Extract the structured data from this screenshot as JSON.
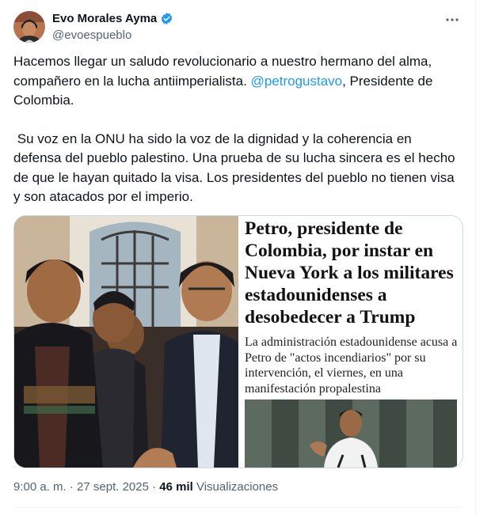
{
  "author": {
    "display_name": "Evo Morales Ayma",
    "handle": "@evoespueblo",
    "verified": true
  },
  "tweet": {
    "p1_a": "Hacemos llegar un saludo revolucionario a nuestro hermano del alma, compañero en la lucha antiimperialista. ",
    "p1_mention": "@petrogustavo",
    "p1_b": ", Presidente de Colombia.",
    "p2": " Su voz en la ONU ha sido la voz de la dignidad y la coherencia en defensa del pueblo palestino. Una prueba de su lucha sincera es el hecho de que le hayan quitado la visa. Los presidentes del pueblo no tienen visa y son atacados por el imperio."
  },
  "media": {
    "headline": "Petro, presidente de Colombia, por instar en Nueva York a los militares estadounidenses a desobedecer a Trump",
    "subhead": "La administración estadounidense acusa a Petro de \"actos incendiarios\" por su intervención, el viernes, en una manifestación propalestina"
  },
  "meta": {
    "timestamp": "9:00 a. m. · 27 sept. 2025 · ",
    "views_count": "46 mil",
    "views_label": " Visualizaciones"
  },
  "colors": {
    "link": "#1d9bf0",
    "verified": "#1d9bf0",
    "secondary_text": "#536471"
  }
}
